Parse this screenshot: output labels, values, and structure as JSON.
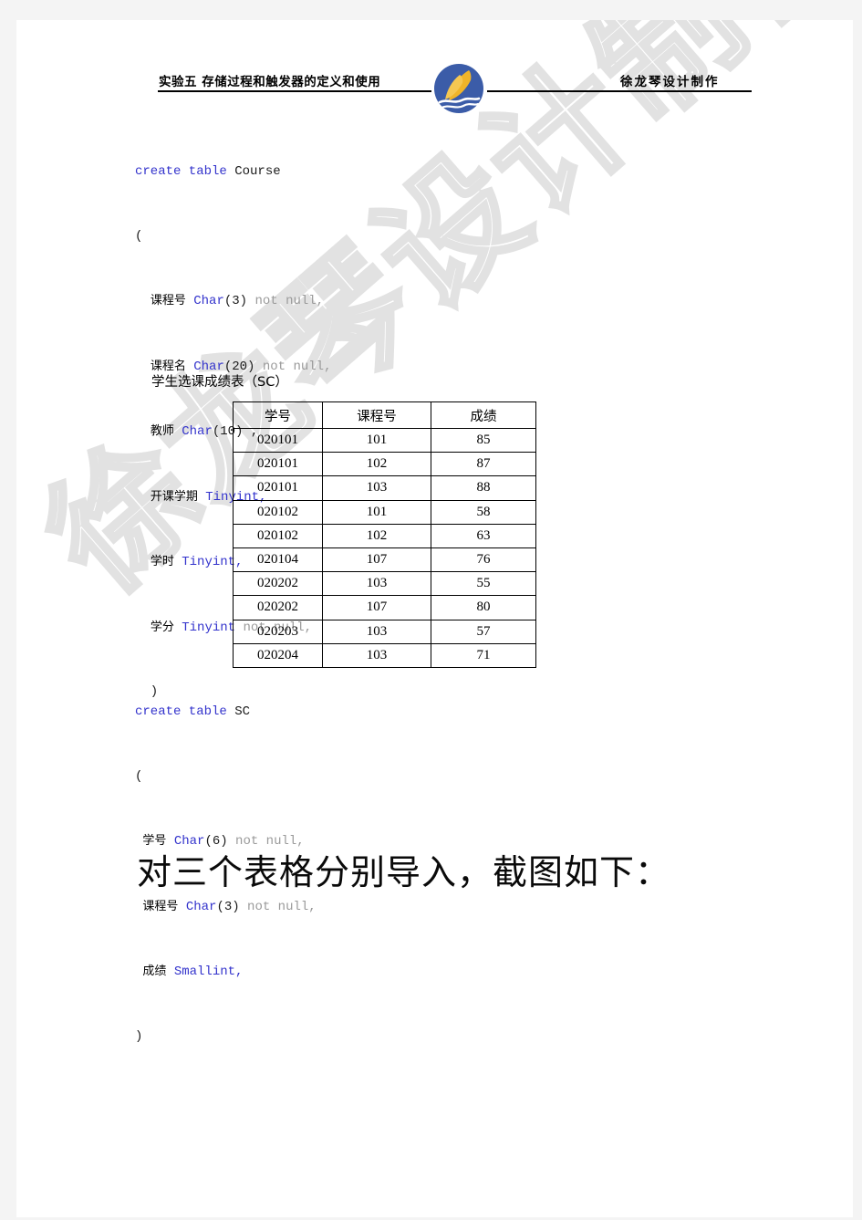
{
  "header": {
    "left_title": "实验五 存储过程和触发器的定义和使用",
    "right_title": "徐龙琴设计制作",
    "logo_name": "sail-boat-logo"
  },
  "watermark": {
    "text": "徐龙琴设计制作",
    "color": "#e2e2e2"
  },
  "code_course": {
    "line1_kw": "create table",
    "line1_name": " Course",
    "line2": "(",
    "fields": [
      {
        "name": "课程号",
        "type": "Char",
        "size": "(3)",
        "constraint": " not null,",
        "indent": true
      },
      {
        "name": "课程名",
        "type": "Char",
        "size": "(20)",
        "constraint": " not null,",
        "indent": true
      },
      {
        "name": "教师",
        "type": "Char",
        "size": "(10)",
        "constraint": " ,",
        "indent": true
      },
      {
        "name": "开课学期",
        "type": "Tinyint",
        "size": "",
        "constraint": ",",
        "indent": true
      },
      {
        "name": "学时",
        "type": "Tinyint",
        "size": "",
        "constraint": ",",
        "indent": true
      },
      {
        "name": "学分",
        "type": "Tinyint",
        "size": "",
        "constraint": " not null,",
        "indent": true
      }
    ],
    "close": "  )"
  },
  "code_sc": {
    "line1_kw": "create table",
    "line1_name": " SC",
    "line2": "(",
    "fields": [
      {
        "name": "学号",
        "type": "Char",
        "size": "(6)",
        "constraint": " not null,"
      },
      {
        "name": "课程号",
        "type": "Char",
        "size": "(3)",
        "constraint": " not null,"
      },
      {
        "name": "成绩",
        "type": "Smallint",
        "size": "",
        "constraint": ","
      }
    ],
    "close": ")"
  },
  "sc_table": {
    "caption": "学生选课成绩表（SC）",
    "columns": [
      "学号",
      "课程号",
      "成绩"
    ],
    "rows": [
      [
        "020101",
        "101",
        "85"
      ],
      [
        "020101",
        "102",
        "87"
      ],
      [
        "020101",
        "103",
        "88"
      ],
      [
        "020102",
        "101",
        "58"
      ],
      [
        "020102",
        "102",
        "63"
      ],
      [
        "020104",
        "107",
        "76"
      ],
      [
        "020202",
        "103",
        "55"
      ],
      [
        "020202",
        "107",
        "80"
      ],
      [
        "020203",
        "103",
        "57"
      ],
      [
        "020204",
        "103",
        "71"
      ]
    ]
  },
  "big_heading": "对三个表格分别导入，截图如下："
}
